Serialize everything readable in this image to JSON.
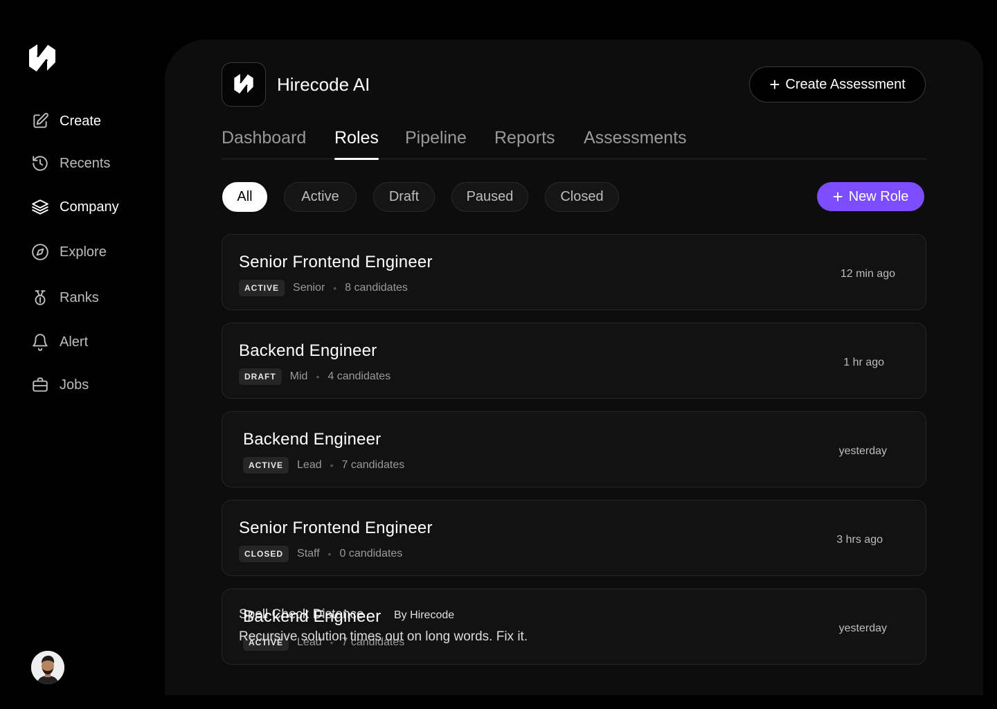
{
  "sidebar": {
    "items": [
      {
        "label": "Create",
        "icon": "edit-icon"
      },
      {
        "label": "Recents",
        "icon": "history-icon"
      },
      {
        "label": "Company",
        "icon": "layers-icon"
      },
      {
        "label": "Explore",
        "icon": "compass-icon"
      },
      {
        "label": "Ranks",
        "icon": "medal-icon"
      },
      {
        "label": "Alert",
        "icon": "bell-icon"
      },
      {
        "label": "Jobs",
        "icon": "briefcase-icon"
      }
    ]
  },
  "header": {
    "brand_name": "Hirecode AI",
    "create_label": "Create Assessment"
  },
  "tabs": [
    "Dashboard",
    "Roles",
    "Pipeline",
    "Reports",
    "Assessments"
  ],
  "filters": [
    "All",
    "Active",
    "Draft",
    "Paused",
    "Closed"
  ],
  "new_role_label": "New Role",
  "roles": [
    {
      "title": "Senior Frontend Engineer",
      "status": "ACTIVE",
      "level": "Senior",
      "candidates": "8 candidates",
      "time": "12 min ago"
    },
    {
      "title": "Backend Engineer",
      "status": "DRAFT",
      "level": "Mid",
      "candidates": "4 candidates",
      "time": "1 hr ago"
    },
    {
      "title": "Backend Engineer",
      "status": "ACTIVE",
      "level": "Lead",
      "candidates": "7 candidates",
      "time": "yesterday"
    },
    {
      "title": "Senior Frontend Engineer",
      "status": "CLOSED",
      "level": "Staff",
      "candidates": "0 candidates",
      "time": "3 hrs ago"
    },
    {
      "title": "Backend Engineer",
      "status": "ACTIVE",
      "level": "Lead",
      "candidates": "7 candidates",
      "time": "yesterday"
    }
  ],
  "ghost": {
    "title": "Spell Check Distance",
    "author": "By Hirecode",
    "desc": "Recursive solution times out on long words. Fix it."
  },
  "colors": {
    "accent": "#7c4dff",
    "background": "#000000",
    "panel": "#0d0d0d"
  }
}
